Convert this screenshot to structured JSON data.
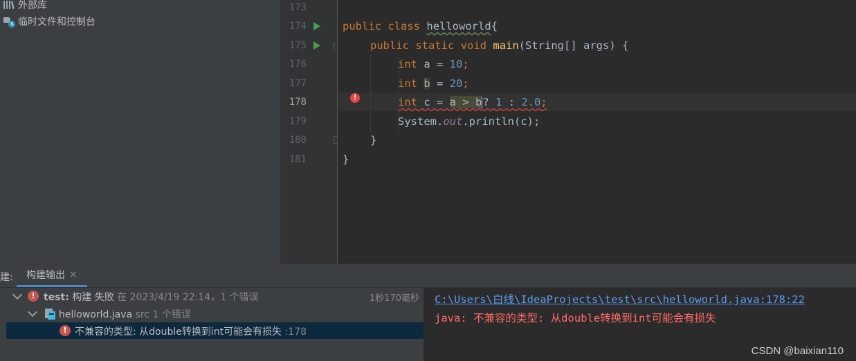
{
  "sidebar": {
    "items": [
      {
        "icon": "library-icon",
        "label": "外部库"
      },
      {
        "icon": "scratches-icon",
        "label": "临时文件和控制台"
      }
    ]
  },
  "editor": {
    "line_numbers": [
      "173",
      "174",
      "175",
      "176",
      "177",
      "178",
      "179",
      "180",
      "181"
    ],
    "current_line": "178",
    "lines": {
      "l174": {
        "kw1": "public",
        "kw2": "class",
        "name": "helloworld",
        "rest": "{"
      },
      "l175": {
        "kw1": "public",
        "kw2": "static",
        "kw3": "void",
        "fn": "main",
        "rest": "(String[] args) {"
      },
      "l176": {
        "kw": "int",
        "rest1": " a = ",
        "num": "10",
        "rest2": ";"
      },
      "l177": {
        "kw": "int",
        "rest1": " ",
        "var": "b",
        "rest2": " = ",
        "num": "20",
        "rest3": ";"
      },
      "l178": {
        "kw": "int",
        "rest1": " c = ",
        "hl": "a > b",
        "rest2": "? ",
        "num1": "1",
        "rest3": " : ",
        "num2": "2.0",
        "rest4": ";"
      },
      "l179": {
        "obj": "System.",
        "field": "out",
        "rest": ".println(c);"
      },
      "l180": {
        "rest": "}"
      },
      "l181": {
        "rest": "}"
      }
    }
  },
  "build_panel": {
    "prefix": "建:",
    "tab_label": "构建输出",
    "tab_close": "×",
    "tree": {
      "root": {
        "name": "test:",
        "text": " 构建 失败",
        "meta": " 在 2023/4/19 22:14，1 个错误",
        "duration": "1秒170毫秒"
      },
      "file": {
        "name": "helloworld.java",
        "meta": " src 1 个错误"
      },
      "error": {
        "text": "不兼容的类型: 从double转换到int可能会有损失",
        "line": " :178"
      }
    },
    "console": {
      "link": "C:\\Users\\白线\\IdeaProjects\\test\\src\\helloworld.java:178:22",
      "error": "java: 不兼容的类型: 从double转换到int可能会有损失"
    },
    "watermark": "CSDN @baixian110"
  },
  "colors": {
    "keyword": "#cc7832",
    "number": "#6897bb",
    "function": "#ffc66d",
    "error": "#c75450",
    "link": "#589df6",
    "selection": "#0d293e"
  }
}
